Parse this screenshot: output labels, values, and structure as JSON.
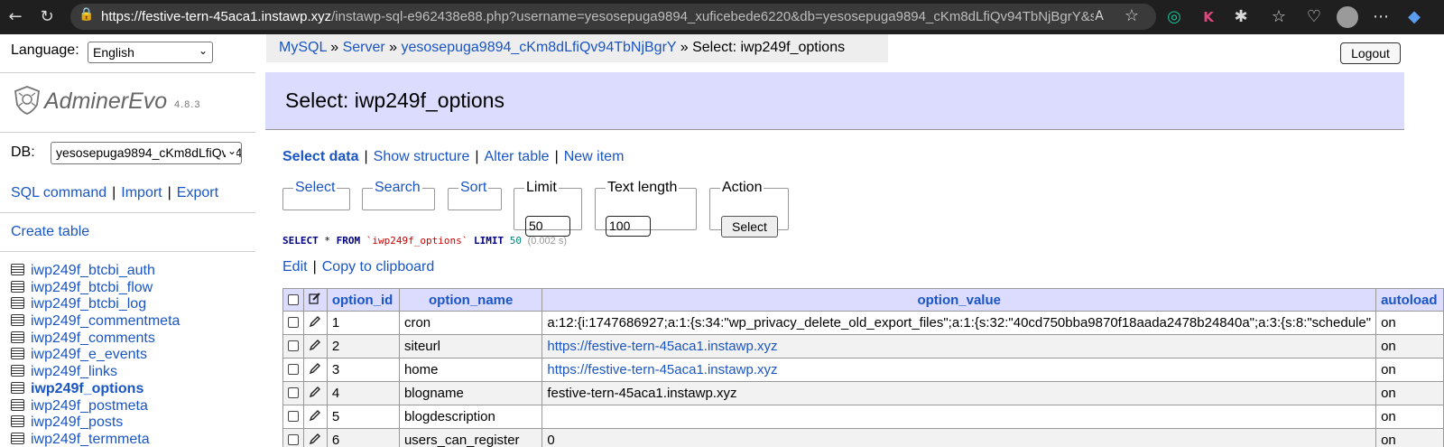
{
  "browser": {
    "url_host": "https://festive-tern-45aca1.instawp.xyz",
    "url_rest": "/instawp-sql-e962438e88.php?username=yesosepuga9894_xuficebede6220&db=yesosepuga9894_cKm8dLfiQv94TbNjBgrY&sele..."
  },
  "sidebar": {
    "language_label": "Language:",
    "language_value": "English",
    "app_name": "AdminerEvo",
    "app_version": "4.8.3",
    "db_label": "DB:",
    "db_value": "yesosepuga9894_cKm8dLfiQv94TbNjBgrY",
    "sql_command": "SQL command",
    "import": "Import",
    "export": "Export",
    "create_table": "Create table",
    "tables": [
      "iwp249f_btcbi_auth",
      "iwp249f_btcbi_flow",
      "iwp249f_btcbi_log",
      "iwp249f_commentmeta",
      "iwp249f_comments",
      "iwp249f_e_events",
      "iwp249f_links",
      "iwp249f_options",
      "iwp249f_postmeta",
      "iwp249f_posts",
      "iwp249f_termmeta"
    ]
  },
  "breadcrumb": {
    "mysql": "MySQL",
    "server": "Server",
    "db": "yesosepuga9894_cKm8dLfiQv94TbNjBgrY",
    "current": "Select: iwp249f_options",
    "sep": "»"
  },
  "logout": "Logout",
  "main": {
    "title": "Select: iwp249f_options",
    "links": [
      "Select data",
      "Show structure",
      "Alter table",
      "New item"
    ],
    "fieldsets": {
      "select": "Select",
      "search": "Search",
      "sort": "Sort",
      "limit": "Limit",
      "limit_value": "50",
      "text_length": "Text length",
      "text_length_value": "100",
      "action": "Action",
      "action_button": "Select"
    },
    "sql": {
      "kw_select": "SELECT",
      "star": "*",
      "kw_from": "FROM",
      "table": "`iwp249f_options`",
      "kw_limit": "LIMIT",
      "limit": "50",
      "time": "(0.002 s)"
    },
    "edit": "Edit",
    "copy": "Copy to clipboard"
  },
  "table": {
    "columns": [
      "option_id",
      "option_name",
      "option_value",
      "autoload"
    ],
    "rows": [
      {
        "id": "1",
        "name": "cron",
        "value": "a:12:{i:1747686927;a:1:{s:34:\"wp_privacy_delete_old_export_files\";a:1:{s:32:\"40cd750bba9870f18aada2478b24840a\";a:3:{s:8:\"schedule\"",
        "value_link": false,
        "autoload": "on"
      },
      {
        "id": "2",
        "name": "siteurl",
        "value": "https://festive-tern-45aca1.instawp.xyz",
        "value_link": true,
        "autoload": "on"
      },
      {
        "id": "3",
        "name": "home",
        "value": "https://festive-tern-45aca1.instawp.xyz",
        "value_link": true,
        "autoload": "on"
      },
      {
        "id": "4",
        "name": "blogname",
        "value": "festive-tern-45aca1.instawp.xyz",
        "value_link": false,
        "autoload": "on"
      },
      {
        "id": "5",
        "name": "blogdescription",
        "value": "",
        "value_link": false,
        "autoload": "on"
      },
      {
        "id": "6",
        "name": "users_can_register",
        "value": "0",
        "value_link": false,
        "autoload": "on"
      }
    ]
  }
}
